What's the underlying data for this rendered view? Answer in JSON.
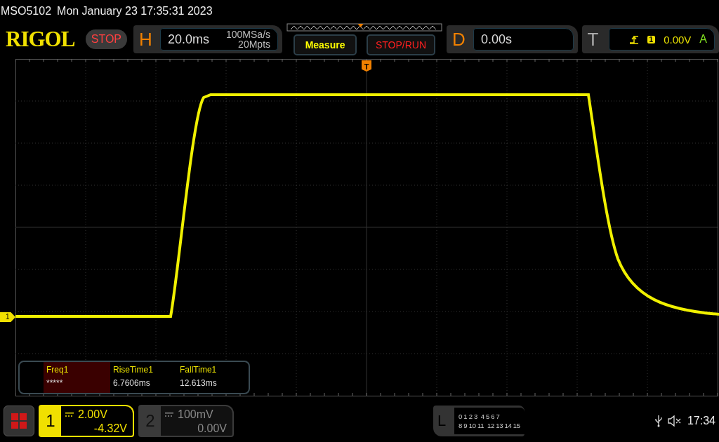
{
  "status_line": {
    "model": "MSO5102",
    "datetime": "Mon January 23 17:35:31 2023"
  },
  "logo": "RIGOL",
  "run_state": "STOP",
  "horizontal": {
    "letter": "H",
    "timebase": "20.0ms",
    "sample_rate": "100MSa/s",
    "memory_depth": "20Mpts"
  },
  "buttons": [
    {
      "label": "Measure",
      "kind": "measure"
    },
    {
      "label": "STOP/RUN",
      "kind": "stoprun"
    }
  ],
  "delay": {
    "letter": "D",
    "value": "0.00s"
  },
  "trigger": {
    "letter": "T",
    "source": "1",
    "level": "0.00V",
    "mode": "A"
  },
  "trigger_marker": "T",
  "channel_marker": "1",
  "measurements": [
    {
      "name": "Freq1",
      "value": "*****",
      "selected": true
    },
    {
      "name": "RiseTime1",
      "value": "6.7606ms",
      "selected": false
    },
    {
      "name": "FallTime1",
      "value": "12.613ms",
      "selected": false
    }
  ],
  "channels": [
    {
      "number": "1",
      "scale": "2.00V",
      "offset": "-4.32V",
      "on": true
    },
    {
      "number": "2",
      "scale": "100mV",
      "offset": "0.00V",
      "on": false
    }
  ],
  "logic": {
    "letter": "L",
    "rows": [
      "0 1 2 3  4 5 6 7",
      "8 9 10 11  12 13 14 15"
    ]
  },
  "memory_slider": {
    "level": 0.48
  },
  "clock": "17:34"
}
